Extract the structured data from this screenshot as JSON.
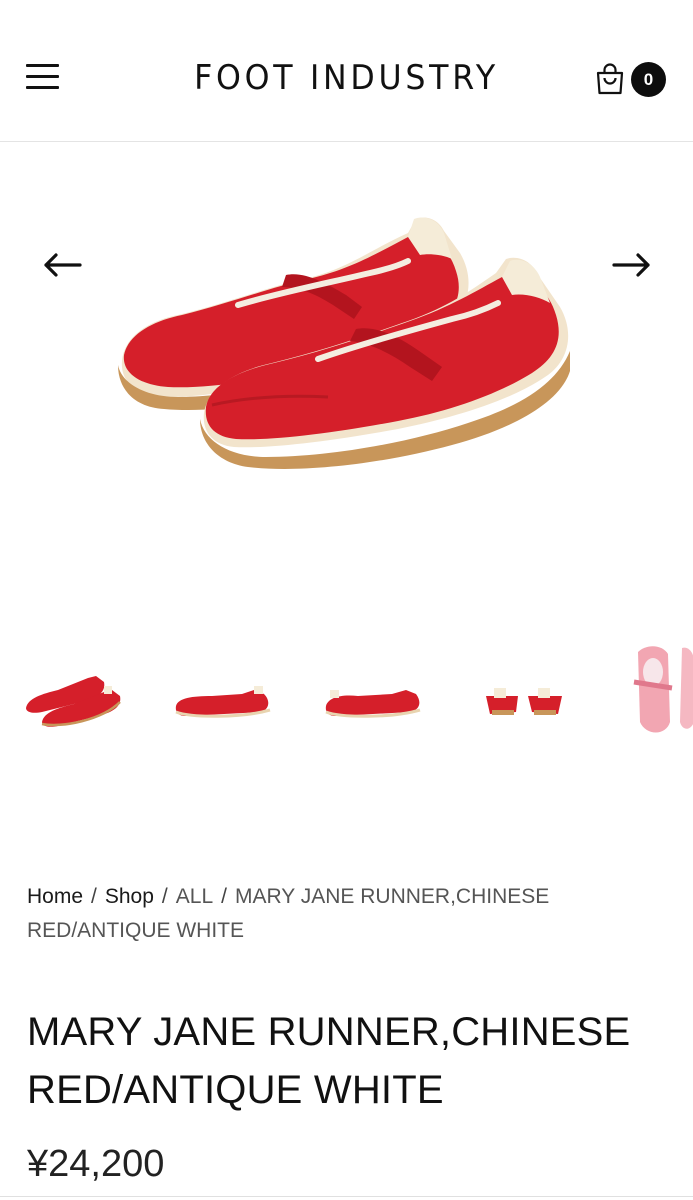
{
  "header": {
    "brand": "FOOT INDUSTRY",
    "cart_count": "0",
    "menu_icon": "hamburger-menu-icon",
    "cart_icon": "shopping-bag-icon"
  },
  "gallery": {
    "prev_icon": "arrow-left-icon",
    "next_icon": "arrow-right-icon",
    "main_image": "red mary jane runner shoes pair",
    "thumbnails": [
      "pair three-quarter view",
      "side view",
      "side view inner",
      "back view pair",
      "top view pink"
    ]
  },
  "breadcrumb": {
    "home": "Home",
    "shop": "Shop",
    "all": "ALL",
    "separator": "/",
    "current": "MARY JANE RUNNER,CHINESE RED/ANTIQUE WHITE"
  },
  "product": {
    "title_line1": "MARY JANE RUNNER,CHINESE",
    "title_line2": "RED/ANTIQUE WHITE",
    "price": "¥24,200"
  },
  "colors": {
    "shoe_red": "#d8202b",
    "sole_cream": "#f3e6cf",
    "gum": "#c79a60",
    "text": "#1a1a1a"
  }
}
